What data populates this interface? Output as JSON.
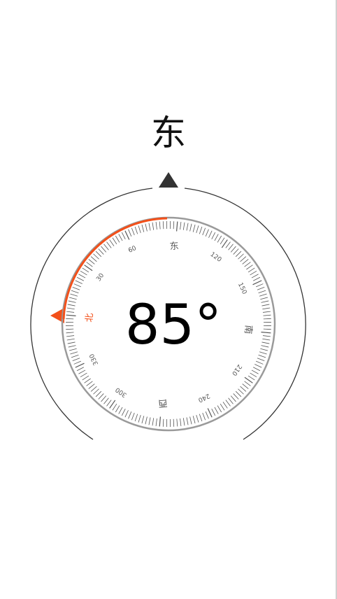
{
  "compass": {
    "direction_label": "东",
    "degree_text": "85°",
    "heading_degrees": 85,
    "north_offset_degrees": 275,
    "dial_labels": {
      "north": "北",
      "east": "东",
      "south": "南",
      "west": "西",
      "d30": "30",
      "d60": "60",
      "d120": "120",
      "d150": "150",
      "d210": "210",
      "d240": "240",
      "d300": "300",
      "d330": "330"
    },
    "icons": {
      "heading_marker": "heading-triangle-icon",
      "north_marker": "north-triangle-icon"
    },
    "colors": {
      "accent": "#f3501a",
      "outer_ring": "#333333",
      "dial_ring": "#9a9a9a",
      "tick": "#555555",
      "marker": "#333333"
    }
  }
}
